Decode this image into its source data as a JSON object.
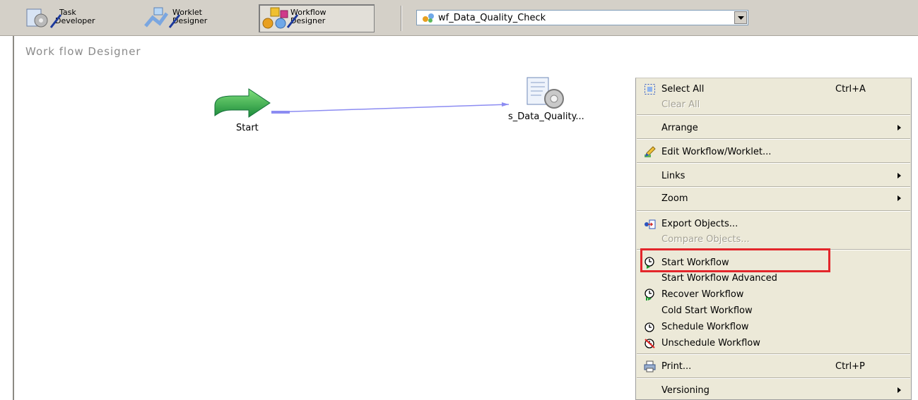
{
  "toolbar": {
    "task_developer": {
      "line1": "Task",
      "line2": "Developer"
    },
    "worklet_designer": {
      "line1": "Worklet",
      "line2": "Designer"
    },
    "workflow_designer": {
      "line1": "Workflow",
      "line2": "Designer"
    },
    "workflow_selector": {
      "value": "wf_Data_Quality_Check"
    }
  },
  "canvas": {
    "title": "Work flow Designer",
    "start_task": {
      "label": "Start"
    },
    "session_task": {
      "label": "s_Data_Quality..."
    }
  },
  "context_menu": {
    "select_all": {
      "label": "Select All",
      "shortcut": "Ctrl+A"
    },
    "clear_all": {
      "label": "Clear All"
    },
    "arrange": {
      "label": "Arrange"
    },
    "edit_workflow": {
      "label": "Edit Workflow/Worklet..."
    },
    "links": {
      "label": "Links"
    },
    "zoom": {
      "label": "Zoom"
    },
    "export_objects": {
      "label": "Export Objects..."
    },
    "compare_objects": {
      "label": "Compare Objects..."
    },
    "start_workflow": {
      "label": "Start Workflow"
    },
    "start_workflow_advanced": {
      "label": "Start Workflow Advanced"
    },
    "recover_workflow": {
      "label": "Recover Workflow"
    },
    "cold_start_workflow": {
      "label": "Cold Start Workflow"
    },
    "schedule_workflow": {
      "label": "Schedule Workflow"
    },
    "unschedule_workflow": {
      "label": "Unschedule Workflow"
    },
    "print": {
      "label": "Print...",
      "shortcut": "Ctrl+P"
    },
    "versioning": {
      "label": "Versioning"
    }
  },
  "colors": {
    "highlight": "#e3262b",
    "link_line": "#8c8cf2",
    "start_arrow": "#2ea84a"
  }
}
